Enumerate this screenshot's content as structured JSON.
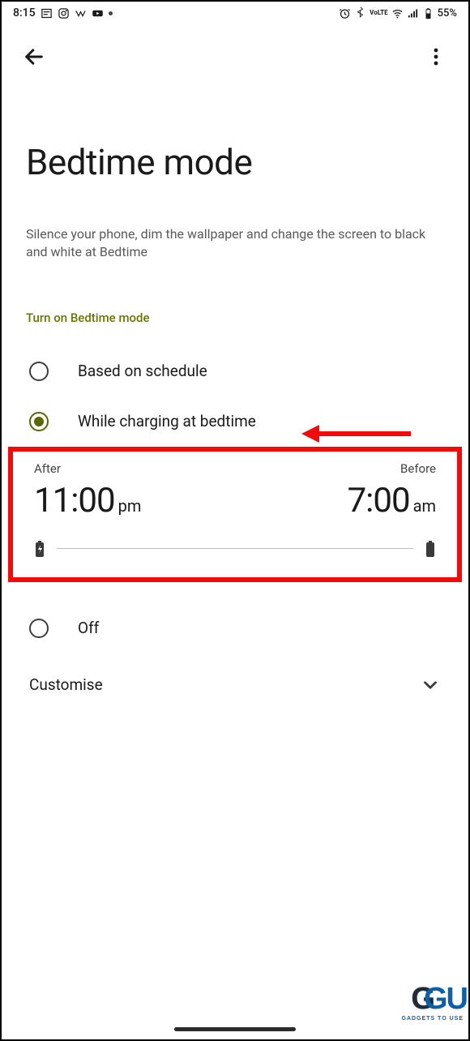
{
  "status": {
    "time": "8:15",
    "battery_pct": "55%",
    "network_label": "VoLTE"
  },
  "appbar": {},
  "page": {
    "title": "Bedtime mode",
    "subtitle": "Silence your phone, dim the wallpaper and change the screen to black and white at Bedtime",
    "section_label": "Turn on Bedtime mode"
  },
  "radios": {
    "schedule": "Based on schedule",
    "charging": "While charging at bedtime",
    "off": "Off",
    "selected": "charging"
  },
  "times": {
    "after_label": "After",
    "after_value": "11:00",
    "after_ampm": "pm",
    "before_label": "Before",
    "before_value": "7:00",
    "before_ampm": "am"
  },
  "customise": {
    "label": "Customise"
  },
  "watermark": {
    "text_g1": "G",
    "text_g2": "G",
    "text_u": "U",
    "sub": "GADGETS TO USE"
  }
}
